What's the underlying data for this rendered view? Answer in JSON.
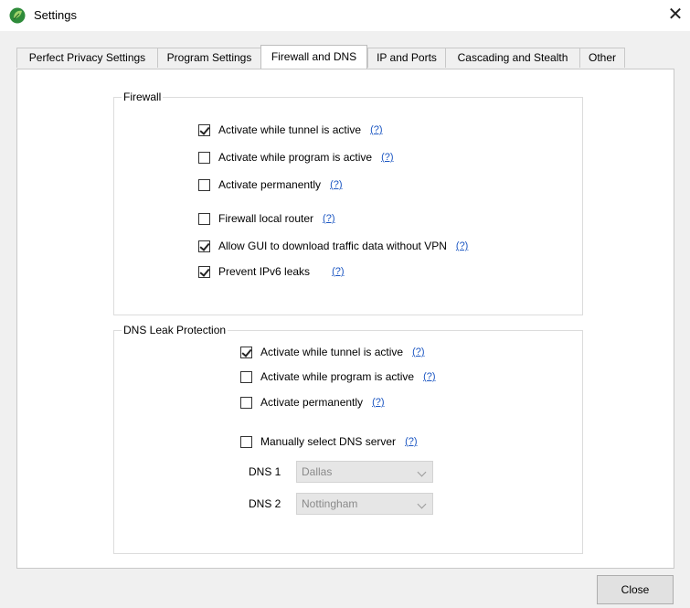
{
  "window": {
    "title": "Settings",
    "app_icon": "green-leaf-icon",
    "close_icon": "close-icon"
  },
  "tabs": [
    {
      "label": "Perfect Privacy Settings",
      "active": false
    },
    {
      "label": "Program Settings",
      "active": false
    },
    {
      "label": "Firewall and DNS",
      "active": true
    },
    {
      "label": "IP and Ports",
      "active": false
    },
    {
      "label": "Cascading and Stealth",
      "active": false
    },
    {
      "label": "Other",
      "active": false
    }
  ],
  "firewall": {
    "title": "Firewall",
    "options": [
      {
        "label": "Activate while tunnel is active",
        "checked": true,
        "help": "(?)"
      },
      {
        "label": "Activate while program is active",
        "checked": false,
        "help": "(?)"
      },
      {
        "label": "Activate permanently",
        "checked": false,
        "help": "(?)"
      },
      {
        "label": "Firewall local router",
        "checked": false,
        "help": "(?)"
      },
      {
        "label": "Allow GUI to download traffic data without VPN",
        "checked": true,
        "help": "(?)"
      },
      {
        "label": "Prevent IPv6 leaks",
        "checked": true,
        "help": "(?)"
      }
    ]
  },
  "dns": {
    "title": "DNS Leak Protection",
    "options": [
      {
        "label": "Activate while tunnel is active",
        "checked": true,
        "help": "(?)"
      },
      {
        "label": "Activate while program is active",
        "checked": false,
        "help": "(?)"
      },
      {
        "label": "Activate permanently",
        "checked": false,
        "help": "(?)"
      },
      {
        "label": "Manually select DNS server",
        "checked": false,
        "help": "(?)"
      }
    ],
    "dns1": {
      "label": "DNS 1",
      "value": "Dallas"
    },
    "dns2": {
      "label": "DNS 2",
      "value": "Nottingham"
    }
  },
  "buttons": {
    "close": "Close"
  },
  "colors": {
    "window_bg": "#f0f0f0",
    "panel_bg": "#ffffff",
    "link": "#1a55c2",
    "icon_green": "#2e8b3a"
  }
}
